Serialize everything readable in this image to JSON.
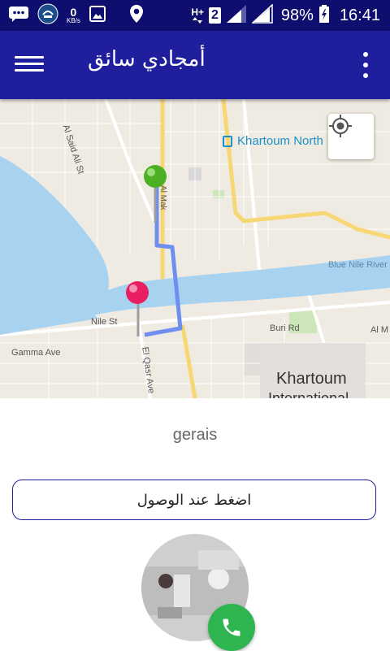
{
  "status_bar": {
    "network_speed": "0",
    "network_unit": "KB/s",
    "network_type": "H+",
    "sim_slot": "2",
    "battery": "98%",
    "time": "16:41"
  },
  "toolbar": {
    "title": "أمجادي سائق"
  },
  "map": {
    "poi_label": "Khartoum North",
    "river_label": "Blue Nile River",
    "city_label": "Khartoum",
    "airport_label_partial": "International",
    "streets": {
      "al_said_ali": "Al Said Ali St",
      "nile_st": "Nile St",
      "gamma_ave": "Gamma Ave",
      "el_qasr_ave": "El Qasr Ave",
      "buri_rd": "Buri Rd",
      "al_m": "Al M",
      "al_mak": "Al Mak"
    },
    "colors": {
      "land": "#efebe2",
      "water": "#a8d3f0",
      "route": "#6f8ff0",
      "origin_pin": "#4caf24",
      "destination_pin": "#e91e63"
    }
  },
  "driver": {
    "name": "gerais"
  },
  "actions": {
    "arrive_label": "اضغط عند الوصول"
  },
  "colors": {
    "status_bar": "#0e0e6e",
    "toolbar": "#1f1f9e",
    "call_button": "#2fb550"
  }
}
